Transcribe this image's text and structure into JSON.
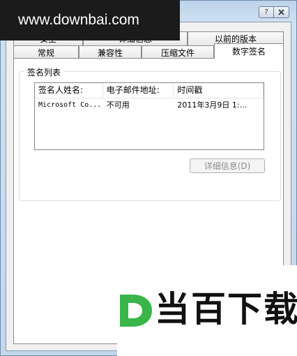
{
  "watermark": {
    "url": "www.downbai.com",
    "brand": "当百下载"
  },
  "window": {
    "controls": {
      "help_icon": "question-icon",
      "close_icon": "close-icon"
    }
  },
  "tabs": {
    "row_back": [
      {
        "label": "安全"
      },
      {
        "label": "详细信息"
      },
      {
        "label": "以前的版本"
      }
    ],
    "row_front": [
      {
        "label": "常规"
      },
      {
        "label": "兼容性"
      },
      {
        "label": "压缩文件"
      },
      {
        "label": "数字签名"
      }
    ],
    "selected": "数字签名"
  },
  "signature_list": {
    "group_label": "签名列表",
    "columns": [
      "签名人姓名:",
      "电子邮件地址:",
      "时间戳"
    ],
    "rows": [
      {
        "name": "Microsoft Co...",
        "email": "不可用",
        "timestamp": "2011年3月9日 1:..."
      }
    ]
  },
  "buttons": {
    "details_label": "详细信息(D)"
  },
  "colors": {
    "window_frame": "#c3d7eb",
    "dialog_bg": "#f0f0f0",
    "panel_bg": "#ffffff",
    "disabled_text": "#8d8d8d",
    "logo_green": "#39b54a"
  }
}
